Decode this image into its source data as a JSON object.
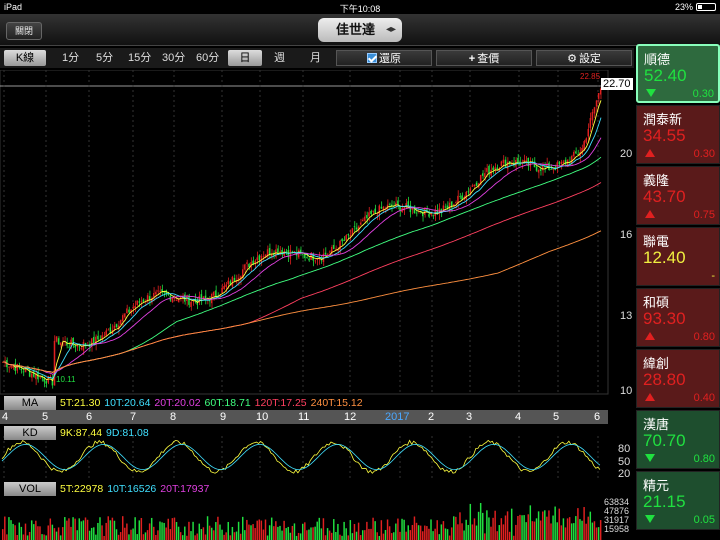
{
  "status": {
    "device": "iPad",
    "time": "下午10:08",
    "battery": "23%"
  },
  "nav": {
    "close_label": "關閉",
    "title": "佳世達",
    "title_arrows": "◂▸"
  },
  "toolbar": {
    "k_label": "K線",
    "periods": [
      "1分",
      "5分",
      "15分",
      "30分",
      "60分"
    ],
    "day": "日",
    "week": "週",
    "month": "月",
    "restore_label": "還原",
    "quote_label": "查價",
    "settings_label": "設定"
  },
  "price_axis": {
    "current": "22.70",
    "high_marker": "22.85",
    "ticks": [
      "20",
      "16",
      "13",
      "10"
    ],
    "low_marker": "10.11"
  },
  "ma": {
    "label": "MA",
    "v5": "5T:21.30",
    "v10": "10T:20.64",
    "v20": "20T:20.02",
    "v60": "60T:18.71",
    "v120": "120T:17.25",
    "v240": "240T:15.12"
  },
  "months": [
    "4",
    "5",
    "6",
    "7",
    "8",
    "9",
    "10",
    "11",
    "12",
    "2017",
    "2",
    "3",
    "4",
    "5",
    "6"
  ],
  "kd": {
    "label": "KD",
    "k": "9K:87.44",
    "d": "9D:81.08",
    "ticks": [
      "80",
      "50",
      "20"
    ]
  },
  "vol": {
    "label": "VOL",
    "v5": "5T:22978",
    "v10": "10T:16526",
    "v20": "20T:17937",
    "ticks": [
      "63834",
      "47876",
      "31917",
      "15958"
    ]
  },
  "colors": {
    "up": "#e02020",
    "down": "#20e040",
    "ma5": "#ffff40",
    "ma10": "#40e0ff",
    "ma20": "#e040e0",
    "ma60": "#40ff80",
    "ma120": "#ff4060",
    "ma240": "#ff9040"
  },
  "watchlist": [
    {
      "name": "順德",
      "price": "52.40",
      "change": "0.30",
      "dir": "down"
    },
    {
      "name": "潤泰新",
      "price": "34.55",
      "change": "0.30",
      "dir": "up"
    },
    {
      "name": "義隆",
      "price": "43.70",
      "change": "0.75",
      "dir": "up"
    },
    {
      "name": "聯電",
      "price": "12.40",
      "change": "-",
      "dir": "flat"
    },
    {
      "name": "和碩",
      "price": "93.30",
      "change": "0.80",
      "dir": "up"
    },
    {
      "name": "緯創",
      "price": "28.80",
      "change": "0.40",
      "dir": "up"
    },
    {
      "name": "漢唐",
      "price": "70.70",
      "change": "0.80",
      "dir": "down"
    },
    {
      "name": "精元",
      "price": "21.15",
      "change": "0.05",
      "dir": "down"
    }
  ]
}
